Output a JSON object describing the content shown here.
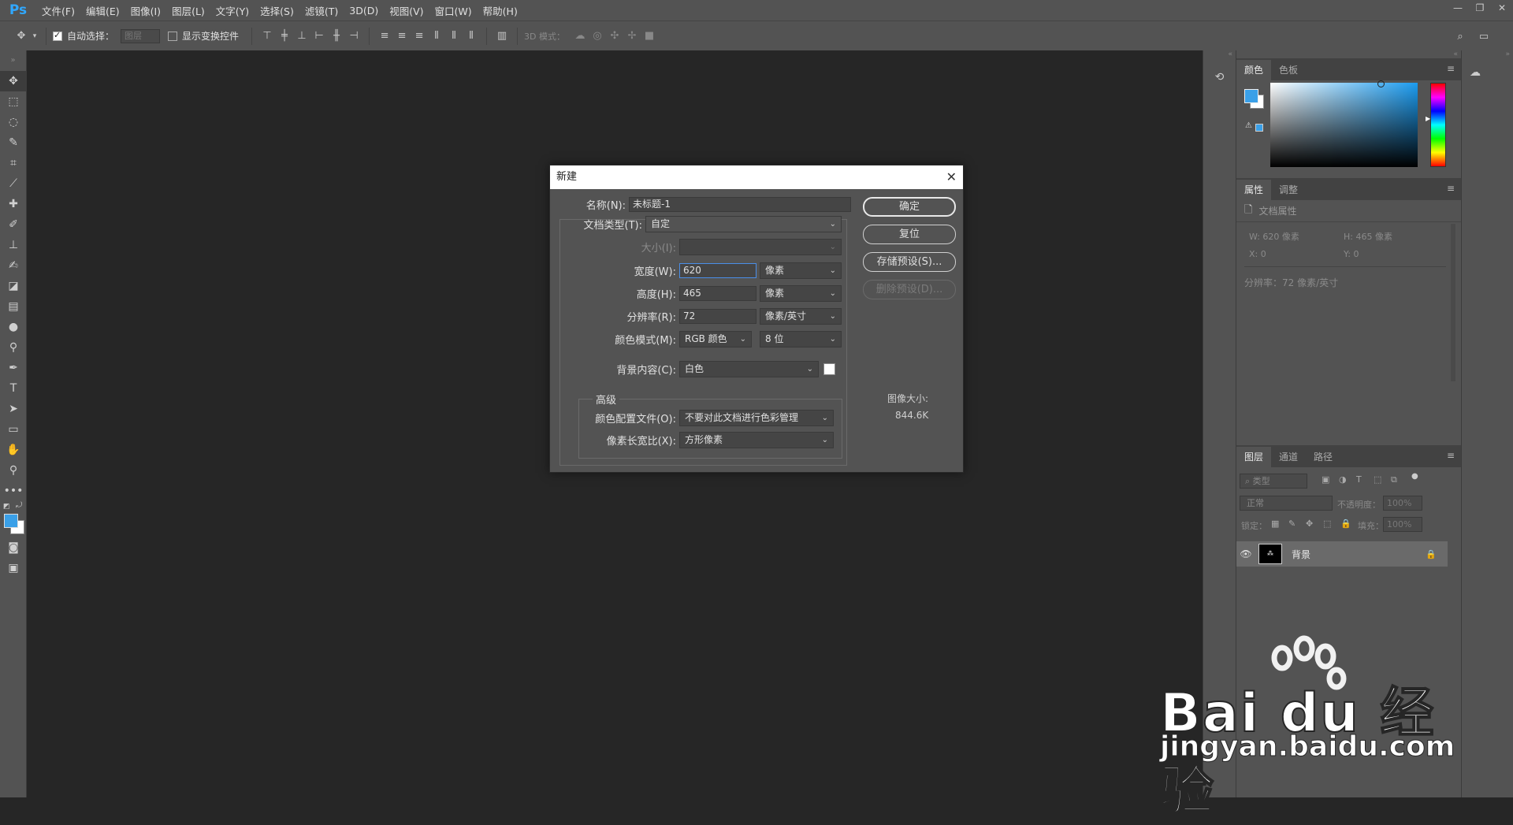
{
  "app": {
    "logo": "Ps",
    "menu": [
      "文件(F)",
      "编辑(E)",
      "图像(I)",
      "图层(L)",
      "文字(Y)",
      "选择(S)",
      "滤镜(T)",
      "3D(D)",
      "视图(V)",
      "窗口(W)",
      "帮助(H)"
    ],
    "window_controls": [
      "—",
      "❐",
      "✕"
    ]
  },
  "options": {
    "auto_select_label": "自动选择：",
    "auto_select_target": "图层",
    "show_transform_label": "显示变换控件",
    "mode_3d_label": "3D 模式："
  },
  "dialog": {
    "title": "新建",
    "name_label": "名称(N):",
    "name_value": "未标题-1",
    "doctype_label": "文档类型(T):",
    "doctype_value": "自定",
    "size_label": "大小(I):",
    "width_label": "宽度(W):",
    "width_value": "620",
    "width_unit": "像素",
    "height_label": "高度(H):",
    "height_value": "465",
    "height_unit": "像素",
    "resolution_label": "分辨率(R):",
    "resolution_value": "72",
    "resolution_unit": "像素/英寸",
    "colormode_label": "颜色模式(M):",
    "colormode_value": "RGB 颜色",
    "bitdepth_value": "8 位",
    "bg_label": "背景内容(C):",
    "bg_value": "白色",
    "advanced_label": "高级",
    "profile_label": "颜色配置文件(O):",
    "profile_value": "不要对此文档进行色彩管理",
    "aspect_label": "像素长宽比(X):",
    "aspect_value": "方形像素",
    "ok_button": "确定",
    "reset_button": "复位",
    "save_preset_button": "存储预设(S)...",
    "delete_preset_button": "删除预设(D)...",
    "image_size_label": "图像大小:",
    "image_size_value": "844.6K"
  },
  "color_panel": {
    "tabs": [
      "颜色",
      "色板"
    ],
    "fg_color": "#3aa0e8",
    "bg_color": "#ffffff"
  },
  "props_panel": {
    "tabs": [
      "属性",
      "调整"
    ],
    "doc_props": "文档属性",
    "w": "W:  620 像素",
    "h": "H:  465 像素",
    "x": "X:  0",
    "y": "Y:  0",
    "resolution": "分辨率：72 像素/英寸"
  },
  "layers_panel": {
    "tabs": [
      "图层",
      "通道",
      "路径"
    ],
    "filter_kind": "类型",
    "blend_mode": "正常",
    "opacity_label": "不透明度：",
    "opacity_value": "100%",
    "lock_label": "锁定：",
    "fill_label": "填充：",
    "fill_value": "100%",
    "layer_name": "背景"
  },
  "watermark": {
    "brand": "Bai du 经验",
    "url": "jingyan.baidu.com"
  }
}
